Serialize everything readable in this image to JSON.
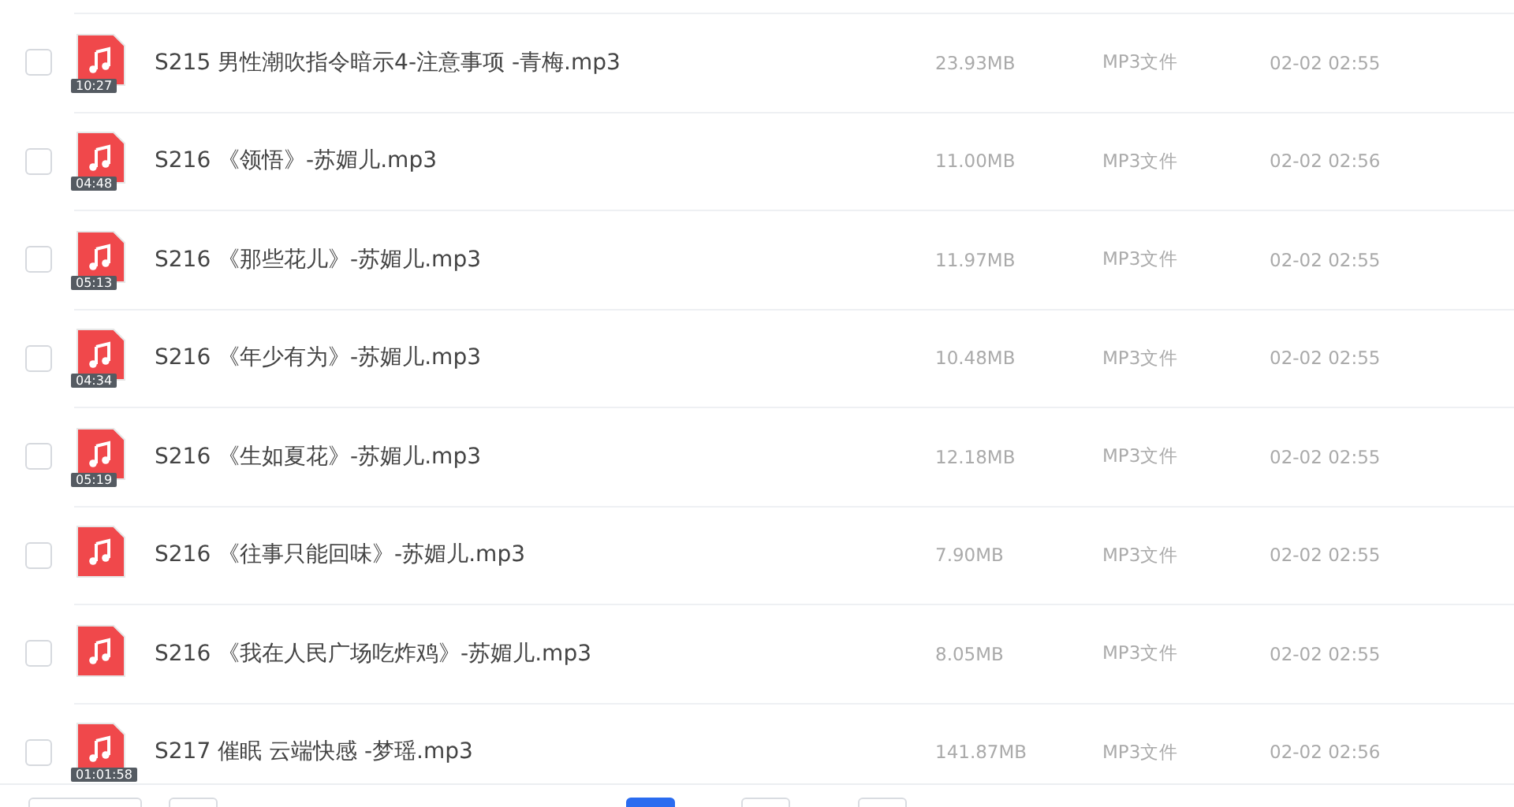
{
  "files": [
    {
      "name": "S215 男性潮吹指令暗示4-注意事项 -青梅.mp3",
      "duration": "10:27",
      "size": "23.93MB",
      "type": "MP3文件",
      "modified": "02-02 02:55",
      "checked": false
    },
    {
      "name": "S216 《领悟》-苏媚儿.mp3",
      "duration": "04:48",
      "size": "11.00MB",
      "type": "MP3文件",
      "modified": "02-02 02:56",
      "checked": false
    },
    {
      "name": "S216 《那些花儿》-苏媚儿.mp3",
      "duration": "05:13",
      "size": "11.97MB",
      "type": "MP3文件",
      "modified": "02-02 02:55",
      "checked": false
    },
    {
      "name": "S216 《年少有为》-苏媚儿.mp3",
      "duration": "04:34",
      "size": "10.48MB",
      "type": "MP3文件",
      "modified": "02-02 02:55",
      "checked": false
    },
    {
      "name": "S216 《生如夏花》-苏媚儿.mp3",
      "duration": "05:19",
      "size": "12.18MB",
      "type": "MP3文件",
      "modified": "02-02 02:55",
      "checked": false
    },
    {
      "name": "S216 《往事只能回味》-苏媚儿.mp3",
      "size": "7.90MB",
      "type": "MP3文件",
      "modified": "02-02 02:55",
      "checked": false
    },
    {
      "name": "S216 《我在人民广场吃炸鸡》-苏媚儿.mp3",
      "size": "8.05MB",
      "type": "MP3文件",
      "modified": "02-02 02:55",
      "checked": false
    },
    {
      "name": "S217 催眠 云端快感 -梦瑶.mp3",
      "duration": "01:01:58",
      "size": "141.87MB",
      "type": "MP3文件",
      "modified": "02-02 02:56",
      "checked": false
    }
  ],
  "pagination": [
    {
      "kind": "wide",
      "selected": false
    },
    {
      "kind": "page",
      "selected": false
    },
    {
      "kind": "page",
      "selected": true
    },
    {
      "kind": "page",
      "selected": false
    },
    {
      "kind": "page",
      "selected": false
    }
  ]
}
